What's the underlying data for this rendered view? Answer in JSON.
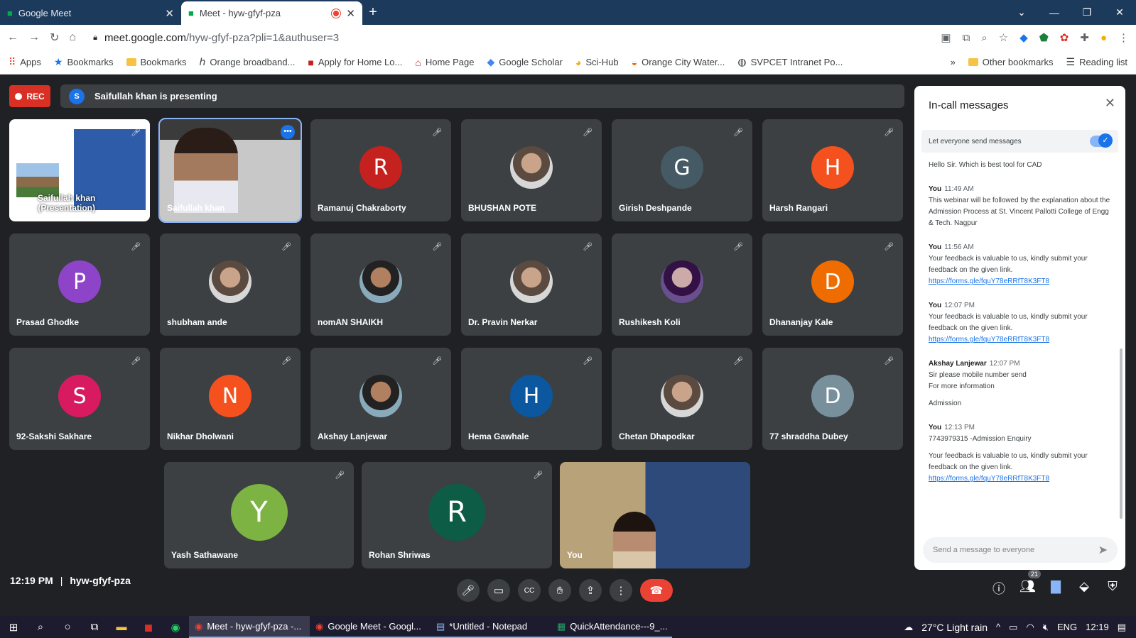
{
  "browser": {
    "tabs": [
      {
        "label": "Google Meet",
        "icon": "meet-icon"
      },
      {
        "label": "Meet - hyw-gfyf-pza",
        "icon": "meet-icon",
        "recording": true
      }
    ],
    "url_host": "meet.google.com",
    "url_path": "/hyw-gfyf-pza?pli=1&authuser=3",
    "bookmarks": [
      {
        "label": "Apps",
        "icon": "apps-icon"
      },
      {
        "label": "Bookmarks",
        "icon": "star-icon"
      },
      {
        "label": "Bookmarks",
        "icon": "folder-icon"
      },
      {
        "label": "Orange broadband...",
        "icon": "orange-icon"
      },
      {
        "label": "Apply for Home Lo...",
        "icon": "bank-icon"
      },
      {
        "label": "Home Page",
        "icon": "home-page-icon"
      },
      {
        "label": "Google Scholar",
        "icon": "scholar-icon"
      },
      {
        "label": "Sci-Hub",
        "icon": "scihub-icon"
      },
      {
        "label": "Orange City Water...",
        "icon": "water-icon"
      },
      {
        "label": "SVPCET Intranet Po...",
        "icon": "globe-icon"
      }
    ],
    "other_bookmarks": "Other bookmarks",
    "reading_list": "Reading list"
  },
  "meet": {
    "rec_label": "REC",
    "presenting_initial": "S",
    "presenting_text": "Saifullah khan is presenting",
    "tiles": [
      {
        "name": "Saifullah khan\n(Presentation)",
        "kind": "presentation"
      },
      {
        "name": "Saifullah khan",
        "kind": "camera",
        "pinned": true
      },
      {
        "name": "Ramanuj Chakraborty",
        "initial": "R",
        "color": "#c5221f"
      },
      {
        "name": "BHUSHAN POTE",
        "kind": "photo"
      },
      {
        "name": "Girish Deshpande",
        "initial": "G",
        "color": "#455a64"
      },
      {
        "name": "Harsh Rangari",
        "initial": "H",
        "color": "#f4511e"
      },
      {
        "name": "Prasad Ghodke",
        "initial": "P",
        "color": "#8e44c8"
      },
      {
        "name": "shubham ande",
        "kind": "photo"
      },
      {
        "name": "nomAN SHAIKH",
        "kind": "photo"
      },
      {
        "name": "Dr. Pravin Nerkar",
        "kind": "photo"
      },
      {
        "name": "Rushikesh Koli",
        "kind": "photo"
      },
      {
        "name": "Dhananjay Kale",
        "initial": "D",
        "color": "#ef6c00"
      },
      {
        "name": "92-Sakshi Sakhare",
        "initial": "S",
        "color": "#d81b60"
      },
      {
        "name": "Nikhar Dholwani",
        "initial": "N",
        "color": "#f4511e"
      },
      {
        "name": "Akshay Lanjewar",
        "kind": "photo"
      },
      {
        "name": "Hema Gawhale",
        "initial": "H",
        "color": "#0b57a0"
      },
      {
        "name": "Chetan Dhapodkar",
        "kind": "photo"
      },
      {
        "name": "77 shraddha Dubey",
        "initial": "D",
        "color": "#78909c"
      },
      {
        "name": "Yash Sathawane",
        "initial": "Y",
        "color": "#7cb342"
      },
      {
        "name": "Rohan Shriwas",
        "initial": "R",
        "color": "#0d5c46"
      },
      {
        "name": "You",
        "kind": "camera"
      }
    ],
    "time": "12:19 PM",
    "separator": "|",
    "meeting_code": "hyw-gfyf-pza",
    "participant_count": "21"
  },
  "chat": {
    "title": "In-call messages",
    "toggle_label": "Let everyone send messages",
    "toggle_on": true,
    "messages": [
      {
        "sender": "",
        "time": "",
        "lines": [
          "Hello Sir. Which is best tool for CAD"
        ]
      },
      {
        "sender": "You",
        "time": "11:49 AM",
        "lines": [
          "This webinar will be followed by the explanation about the Admission Process at St. Vincent Pallotti College of Engg & Tech. Nagpur"
        ]
      },
      {
        "sender": "You",
        "time": "11:56 AM",
        "lines": [
          "Your feedback is valuable to us, kindly submit your feedback on the given link."
        ],
        "link": "https://forms.gle/fquY78eRRfT8K3FT8"
      },
      {
        "sender": "You",
        "time": "12:07 PM",
        "lines": [
          "Your feedback is valuable to us, kindly submit your feedback on the given link."
        ],
        "link": "https://forms.gle/fquY78eRRfT8K3FT8"
      },
      {
        "sender": "Akshay Lanjewar",
        "time": "12:07 PM",
        "lines": [
          "Sir please mobile number send",
          "For more information",
          "",
          "Admission"
        ]
      },
      {
        "sender": "You",
        "time": "12:13 PM",
        "lines": [
          "7743979315 -Admission Enquiry",
          "",
          "Your feedback is valuable to us, kindly submit your feedback on the given link."
        ],
        "link": "https://forms.gle/fquY78eRRfT8K3FT8"
      }
    ],
    "compose_placeholder": "Send a message to everyone"
  },
  "taskbar": {
    "tasks": [
      "Meet - hyw-gfyf-pza -...",
      "Google Meet - Googl...",
      "*Untitled - Notepad",
      "QuickAttendance---9_..."
    ],
    "weather": "27°C  Light rain",
    "lang": "ENG",
    "clock": "12:19"
  }
}
